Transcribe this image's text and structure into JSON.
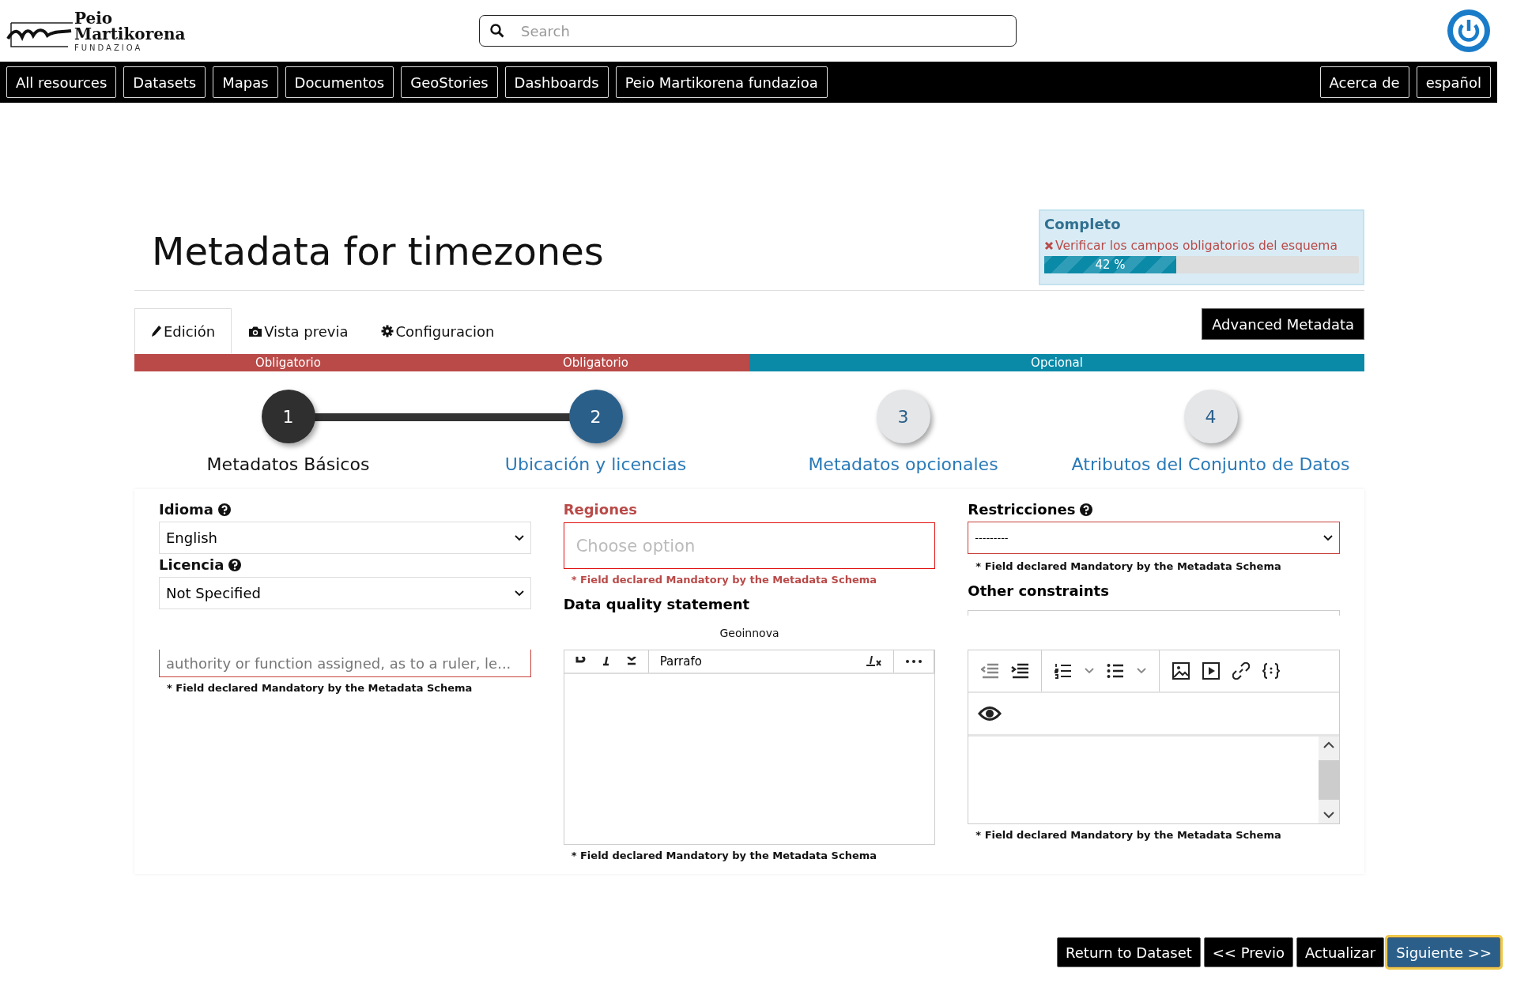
{
  "header": {
    "logo": {
      "line1": "Peio",
      "line2": "Martikorena",
      "line3": "FUNDAZIOA"
    },
    "search": {
      "placeholder": "Search"
    }
  },
  "nav": {
    "items": [
      "All resources",
      "Datasets",
      "Mapas",
      "Documentos",
      "GeoStories",
      "Dashboards",
      "Peio Martikorena fundazioa"
    ],
    "right_items": [
      "Acerca de",
      "español"
    ]
  },
  "title": "Metadata for timezones",
  "completeness": {
    "heading": "Completo",
    "warning": "Verificar los campos obligatorios del esquema",
    "level": 0.42,
    "reading": "42 %"
  },
  "tabs": [
    {
      "label": "Edición",
      "kind": "pencil",
      "selected": true
    },
    {
      "label": "Vista previa",
      "kind": "camera",
      "selected": false
    },
    {
      "label": "Configuracion",
      "kind": "gear",
      "selected": false
    }
  ],
  "advanced_button": "Advanced Metadata",
  "sections": [
    {
      "label": "Obligatorio",
      "kind": "mandatory"
    },
    {
      "label": "Obligatorio",
      "kind": "mandatory"
    },
    {
      "label": "Opcional",
      "kind": "optional"
    }
  ],
  "steps": [
    {
      "number": "1",
      "label": "Metadatos Básicos",
      "done": true,
      "selected": false
    },
    {
      "number": "2",
      "label": "Ubicación y licencias",
      "done": false,
      "selected": true
    },
    {
      "number": "3",
      "label": "Metadatos opcionales",
      "done": false,
      "selected": false
    },
    {
      "number": "4",
      "label": "Atributos del Conjunto de Datos",
      "done": false,
      "selected": false
    }
  ],
  "form": {
    "idioma": {
      "label": "Idioma",
      "value": "English",
      "error": false
    },
    "licencia": {
      "label": "Licencia",
      "value": "Not Specified",
      "error": false
    },
    "col1_field": {
      "placeholder": "authority or function assigned, as to a ruler, le...",
      "error": true,
      "note": "* Field declared Mandatory by the Metadata Schema"
    },
    "regiones": {
      "label": "Regiones",
      "placeholder": "Choose option",
      "error": true,
      "note": "* Field declared Mandatory by the Metadata Schema"
    },
    "quality": {
      "label": "Data quality statement",
      "paragraph": "Parrafo",
      "note": "* Field declared Mandatory by the Metadata Schema"
    },
    "restricciones": {
      "label": "Restricciones",
      "value": "---------",
      "error": true,
      "note": "* Field declared Mandatory by the Metadata Schema"
    },
    "other": {
      "label": "Other constraints",
      "note": "* Field declared Mandatory by the Metadata Schema"
    },
    "caption": "Geoinnova"
  },
  "footer_buttons": [
    {
      "label": "Return to Dataset",
      "primary": false
    },
    {
      "label": "<< Previo",
      "primary": false
    },
    {
      "label": "Actualizar",
      "primary": false
    },
    {
      "label": "Siguiente >>",
      "primary": true
    }
  ]
}
